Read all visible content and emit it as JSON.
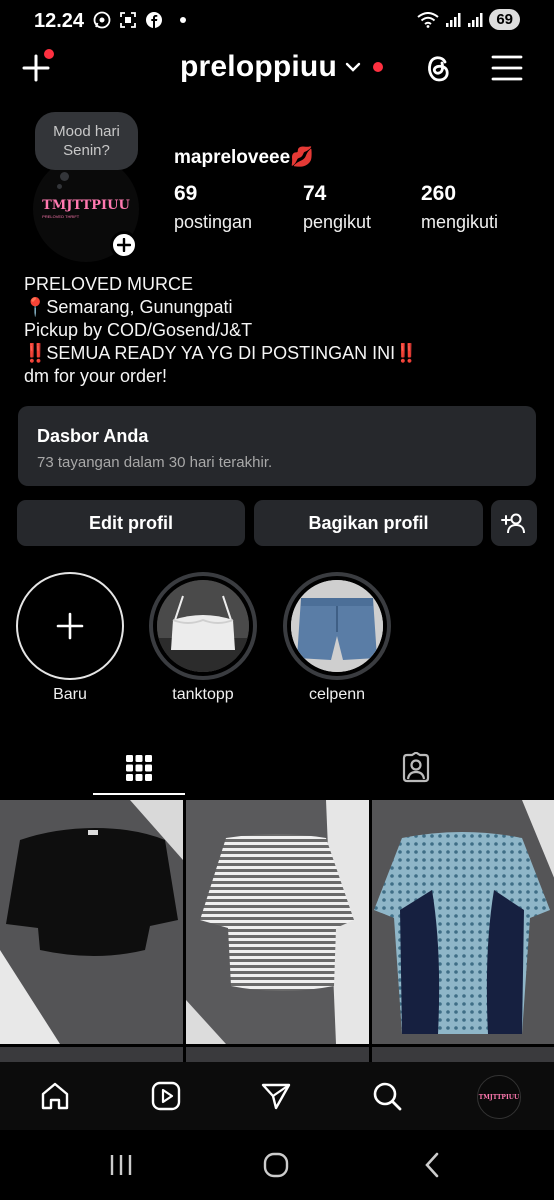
{
  "status_bar": {
    "time": "12.24",
    "battery": "69",
    "icons_left": [
      "whatsapp-icon",
      "screenshot-icon",
      "facebook-icon",
      "dot"
    ],
    "icons_right": [
      "wifi-icon",
      "signal-icon",
      "signal-icon",
      "battery-icon"
    ]
  },
  "header": {
    "username": "preloppiuu",
    "icons": [
      "create-icon",
      "chevron-down-icon",
      "threads-icon",
      "menu-icon"
    ],
    "notification_color": "#ff3040"
  },
  "profile": {
    "mood_note": "Mood hari Senin?",
    "display_name": "mapreloveee💋",
    "stats": [
      {
        "value": "69",
        "label": "postingan"
      },
      {
        "value": "74",
        "label": "pengikut"
      },
      {
        "value": "260",
        "label": "mengikuti"
      }
    ],
    "bio_lines": [
      "PRELOVED MURCE",
      "📍Semarang, Gunungpati",
      "Pickup by COD/Gosend/J&T",
      "‼️SEMUA READY YA YG DI POSTINGAN INI‼️",
      "dm for your order!"
    ]
  },
  "dashboard": {
    "title": "Dasbor Anda",
    "subtitle": "73 tayangan dalam 30 hari terakhir."
  },
  "buttons": {
    "edit": "Edit profil",
    "share": "Bagikan profil"
  },
  "highlights": [
    {
      "label": "Baru"
    },
    {
      "label": "tanktopp"
    },
    {
      "label": "celpenn"
    }
  ],
  "tabs": [
    "grid-icon",
    "tagged-icon"
  ],
  "posts": [
    "black top",
    "striped top",
    "blue patterned top"
  ],
  "bottom_nav": [
    "home-icon",
    "reels-icon",
    "send-icon",
    "search-icon",
    "profile-avatar"
  ],
  "system_nav": [
    "recents-icon",
    "home-circle-icon",
    "back-icon"
  ]
}
